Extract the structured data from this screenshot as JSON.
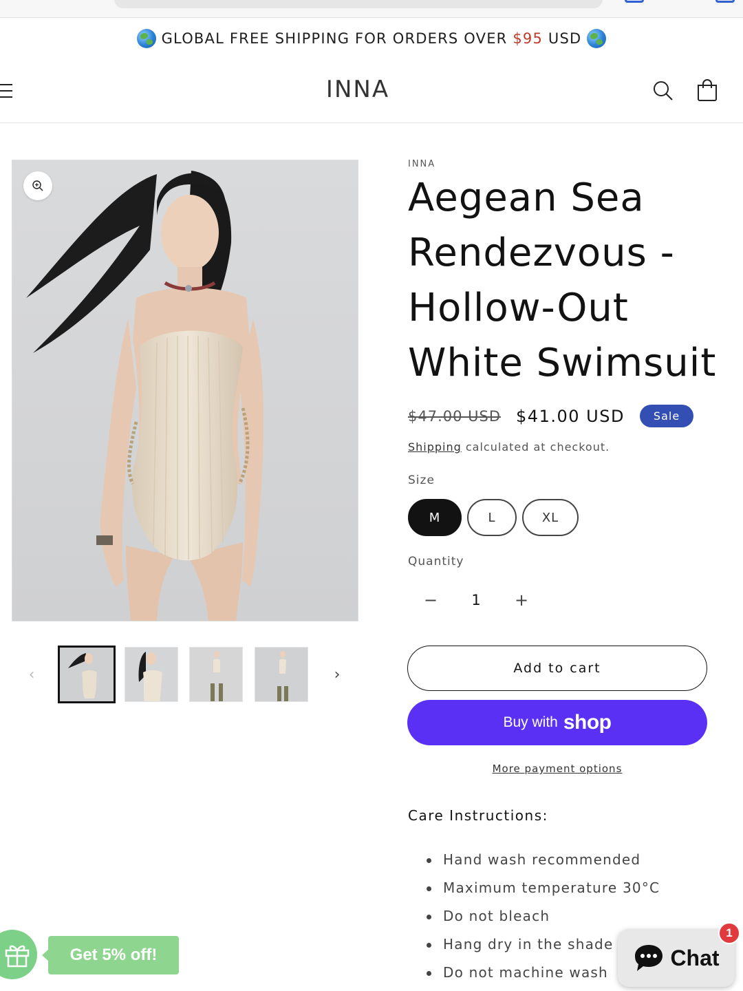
{
  "announcement": {
    "text_before": "GLOBAL FREE SHIPPING FOR ORDERS OVER ",
    "amount": "$95",
    "text_after": " USD"
  },
  "header": {
    "logo": "INNA",
    "icons": [
      "menu-icon",
      "search-icon",
      "cart-icon"
    ]
  },
  "product": {
    "vendor": "INNA",
    "title": "Aegean Sea Rendezvous - Hollow-Out White Swimsuit",
    "price_regular": "$47.00 USD",
    "price_sale": "$41.00 USD",
    "sale_badge": "Sale",
    "shipping_link": "Shipping",
    "shipping_text": " calculated at checkout.",
    "size_label": "Size",
    "sizes": [
      "M",
      "L",
      "XL"
    ],
    "selected_size": "M",
    "quantity_label": "Quantity",
    "quantity": "1",
    "qty_minus": "−",
    "qty_plus": "+",
    "add_to_cart": "Add to cart",
    "buy_with": "Buy with",
    "shop_word": "shop",
    "more_payment": "More payment options"
  },
  "gallery": {
    "prev": "‹",
    "next": "›",
    "thumb_count": 4,
    "active_thumb": 0
  },
  "care": {
    "title": "Care Instructions:",
    "items": [
      "Hand wash recommended",
      "Maximum temperature 30°C",
      "Do not bleach",
      "Hang dry in the shade",
      "Do not machine wash"
    ]
  },
  "widgets": {
    "promo": "Get 5% off!",
    "chat": "Chat",
    "chat_badge": "1"
  },
  "colors": {
    "sale_badge": "#334fb4",
    "shop_pay": "#5a31f4",
    "promo_green": "#8ed68f",
    "announcement_price": "#c0392b"
  }
}
